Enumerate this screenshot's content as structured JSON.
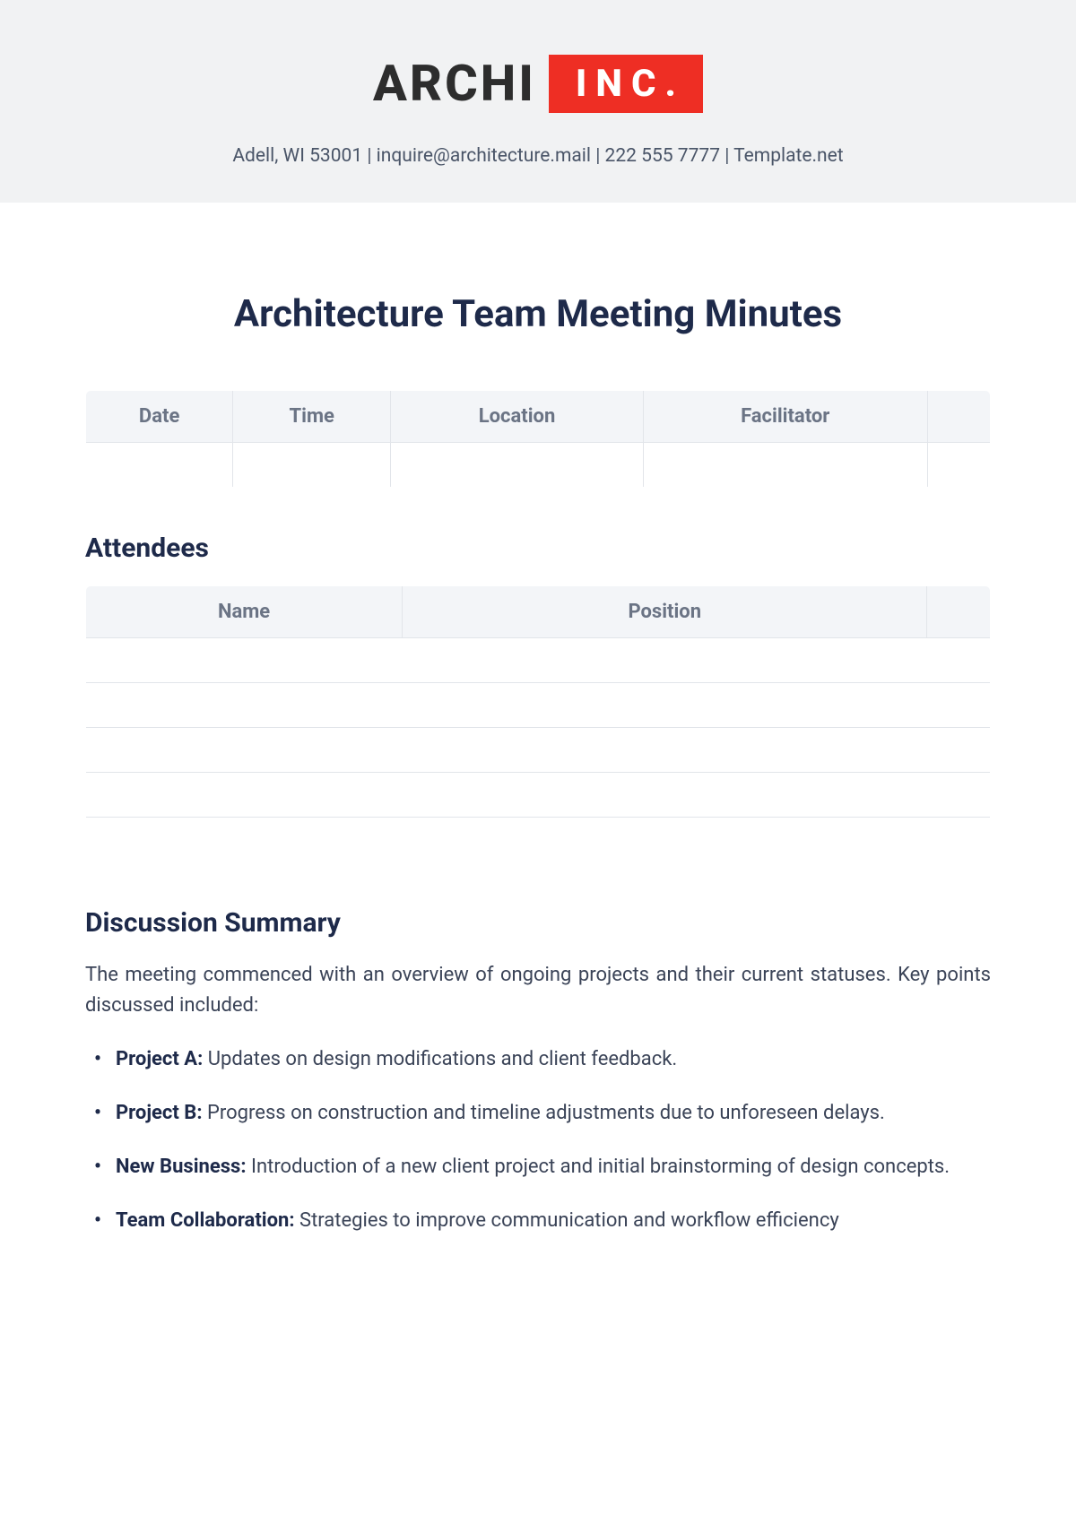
{
  "logo": {
    "archi": "ARCHI",
    "inc": "INC."
  },
  "contact": "Adell, WI 53001 | inquire@architecture.mail | 222 555 7777 | Template.net",
  "title": "Architecture Team Meeting Minutes",
  "meta_headers": {
    "date": "Date",
    "time": "Time",
    "location": "Location",
    "facilitator": "Facilitator"
  },
  "meta_values": {
    "date": "",
    "time": "",
    "location": "",
    "facilitator": ""
  },
  "attendees_heading": "Attendees",
  "attendees_headers": {
    "name": "Name",
    "position": "Position"
  },
  "attendees_rows": [
    {
      "name": "",
      "position": ""
    },
    {
      "name": "",
      "position": ""
    },
    {
      "name": "",
      "position": ""
    },
    {
      "name": "",
      "position": ""
    },
    {
      "name": "",
      "position": ""
    }
  ],
  "discussion_heading": "Discussion Summary",
  "discussion_intro": "The meeting commenced with an overview of ongoing projects and their current statuses. Key points discussed included:",
  "bullets": [
    {
      "label": "Project A:",
      "text": " Updates on design modifications and client feedback."
    },
    {
      "label": "Project B:",
      "text": " Progress on construction and timeline adjustments due to unforeseen delays."
    },
    {
      "label": "New Business:",
      "text": " Introduction of a new client project and initial brainstorming of design concepts."
    },
    {
      "label": "Team Collaboration:",
      "text": " Strategies to improve communication and workflow efficiency"
    }
  ]
}
